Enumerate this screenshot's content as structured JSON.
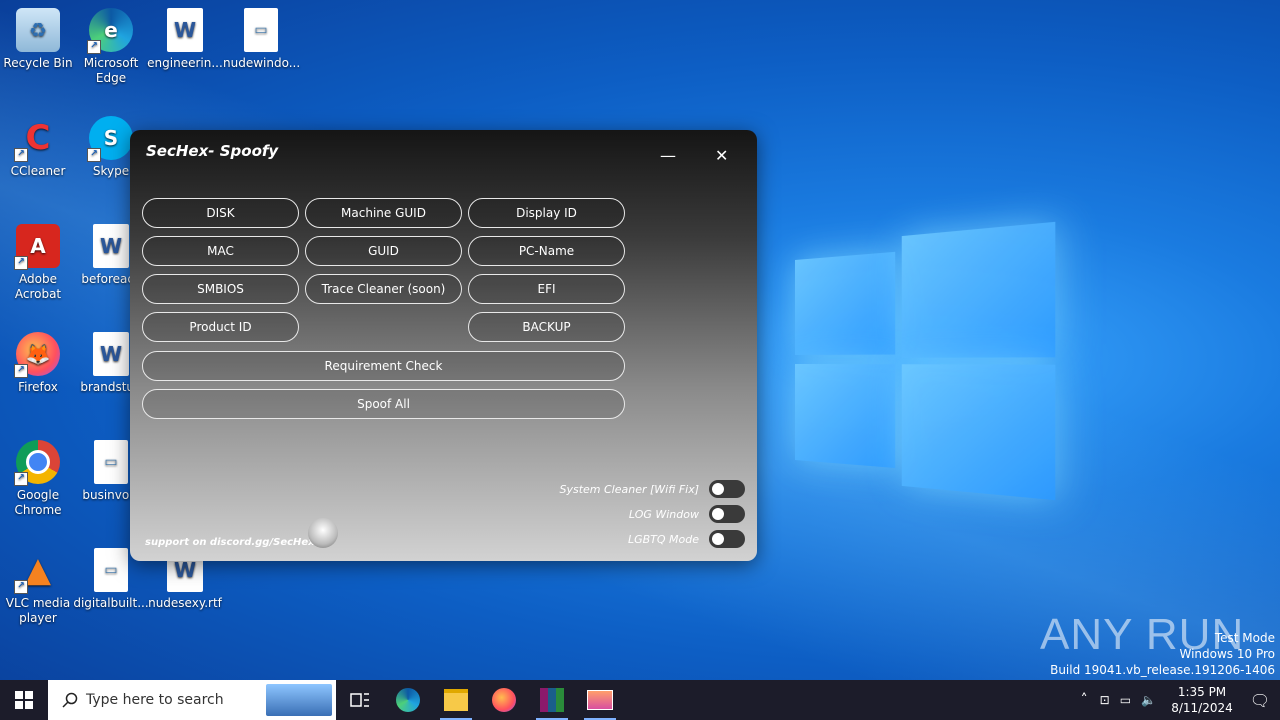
{
  "desktop": {
    "icons": [
      {
        "label": "Recycle Bin"
      },
      {
        "label": "Microsoft Edge"
      },
      {
        "label": "engineerin..."
      },
      {
        "label": "nudewindo..."
      },
      {
        "label": "CCleaner"
      },
      {
        "label": "Skype"
      },
      {
        "label": "Adobe Acrobat"
      },
      {
        "label": "beforeacc"
      },
      {
        "label": "Firefox"
      },
      {
        "label": "brandstud"
      },
      {
        "label": "Google Chrome"
      },
      {
        "label": "businvolv"
      },
      {
        "label": "VLC media player"
      },
      {
        "label": "digitalbuilt..."
      },
      {
        "label": "nudesexy.rtf"
      }
    ]
  },
  "app": {
    "title": "SecHex- Spoofy",
    "minimize": "—",
    "close": "✕",
    "buttons": {
      "disk": "DISK",
      "machine_guid": "Machine GUID",
      "display_id": "Display ID",
      "mac": "MAC",
      "guid": "GUID",
      "pc_name": "PC-Name",
      "smbios": "SMBIOS",
      "trace_cleaner": "Trace Cleaner (soon)",
      "efi": "EFI",
      "product_id": "Product ID",
      "backup": "BACKUP",
      "requirement_check": "Requirement Check",
      "spoof_all": "Spoof All"
    },
    "toggles": {
      "system_cleaner": "System Cleaner [Wifi Fix]",
      "log_window": "LOG Window",
      "lgbtq_mode": "LGBTQ Mode"
    },
    "support": "support on discord.gg/SecHex"
  },
  "taskbar": {
    "search_placeholder": "Type here to search",
    "time": "1:35 PM",
    "date": "8/11/2024"
  },
  "watermark": {
    "line1": "Test Mode",
    "line2": "Windows 10 Pro",
    "line3": "Build 19041.vb_release.191206-1406"
  },
  "anyrun_logo": "ANY RUN"
}
